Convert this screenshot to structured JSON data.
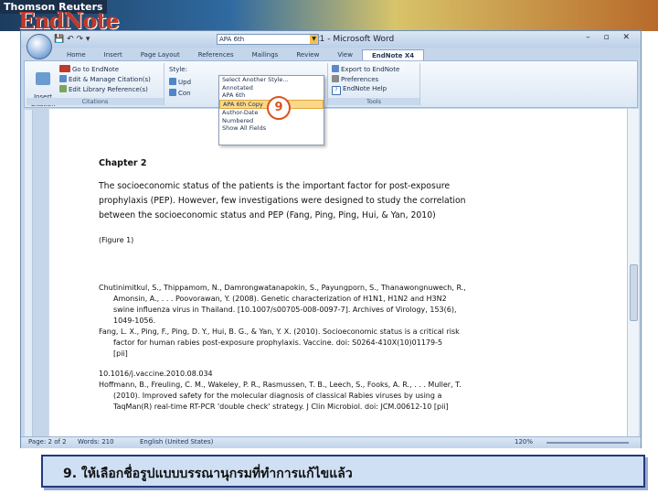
{
  "banner": {
    "brand": "Thomson Reuters",
    "logo": "EndNote"
  },
  "window": {
    "title": "Document1 - Microsoft Word",
    "controls": "– ▫ ✕"
  },
  "tabs": [
    "Home",
    "Insert",
    "Page Layout",
    "References",
    "Mailings",
    "Review",
    "View",
    "EndNote X4"
  ],
  "ribbon": {
    "insert_citation": "Insert\nCitation",
    "go_to_endnote": "Go to EndNote",
    "edit_manage": "Edit & Manage Citation(s)",
    "edit_library": "Edit Library Reference(s)",
    "group_citations": "Citations",
    "style_label": "Style:",
    "style_value": "APA 6th",
    "update": "Upd",
    "convert": "Con",
    "export": "Export to EndNote",
    "preferences": "Preferences",
    "help": "EndNote Help",
    "group_tools": "Tools"
  },
  "dropdown": {
    "options": [
      "Select Another Style...",
      "Annotated",
      "APA 6th",
      "APA 6th Copy",
      "Author-Date",
      "Numbered",
      "Show All Fields"
    ],
    "highlighted": "APA 6th Copy"
  },
  "step_badge": "9",
  "document": {
    "heading": "Chapter 2",
    "para1": "The socioeconomic status of the patients is the important factor for post-exposure",
    "para2": "prophylaxis (PEP). However, few investigations were designed to study the correlation",
    "para3": "between the socioeconomic status and PEP (Fang, Ping, Ping, Hui, & Yan, 2010)",
    "figure": "(Figure 1)",
    "refs": [
      "Chutinimitkul, S., Thippamom, N., Damrongwatanapokin, S., Payungporn, S., Thanawongnuwech, R.,",
      "Amonsin, A., . . . Poovorawan, Y. (2008). Genetic characterization of H1N1, H1N2 and H3N2",
      "swine influenza virus in Thailand. [10.1007/s00705-008-0097-7]. Archives of Virology, 153(6),",
      "1049-1056.",
      "Fang, L. X., Ping, F., Ping, D. Y., Hui, B. G., & Yan, Y. X. (2010). Socioeconomic status is a critical risk",
      "factor for human rabies post-exposure prophylaxis. Vaccine. doi: S0264-410X(10)01179-5",
      "[pii]",
      "10.1016/j.vaccine.2010.08.034",
      "Hoffmann, B., Freuling, C. M., Wakeley, P. R., Rasmussen, T. B., Leech, S., Fooks, A. R., . . . Muller, T.",
      "(2010). Improved safety for the molecular diagnosis of classical Rabies viruses by using a",
      "TaqMan(R) real-time RT-PCR 'double check' strategy. J Clin Microbiol. doi: JCM.00612-10 [pii]"
    ]
  },
  "status": {
    "page": "Page: 2 of 2",
    "words": "Words: 210",
    "language": "English (United States)",
    "zoom": "120%"
  },
  "caption": "9. ให้เลือกชื่อรูปแบบบรรณานุกรมที่ทำการแก้ไขแล้ว"
}
